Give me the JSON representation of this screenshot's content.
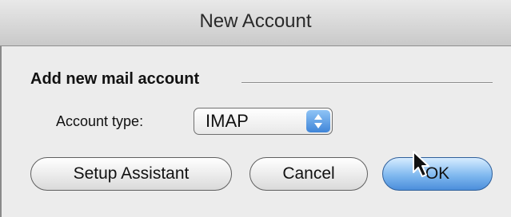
{
  "window": {
    "title": "New Account"
  },
  "section": {
    "label": "Add new mail account"
  },
  "account_type": {
    "label": "Account type:",
    "value": "IMAP"
  },
  "buttons": {
    "setup_assistant": "Setup Assistant",
    "cancel": "Cancel",
    "ok": "OK"
  },
  "colors": {
    "default_button": "#7fb8ef",
    "popup_arrows": "#3f85d8"
  },
  "icons": {
    "popup_arrows": "up-down-arrows-icon",
    "cursor": "mouse-pointer-icon"
  }
}
